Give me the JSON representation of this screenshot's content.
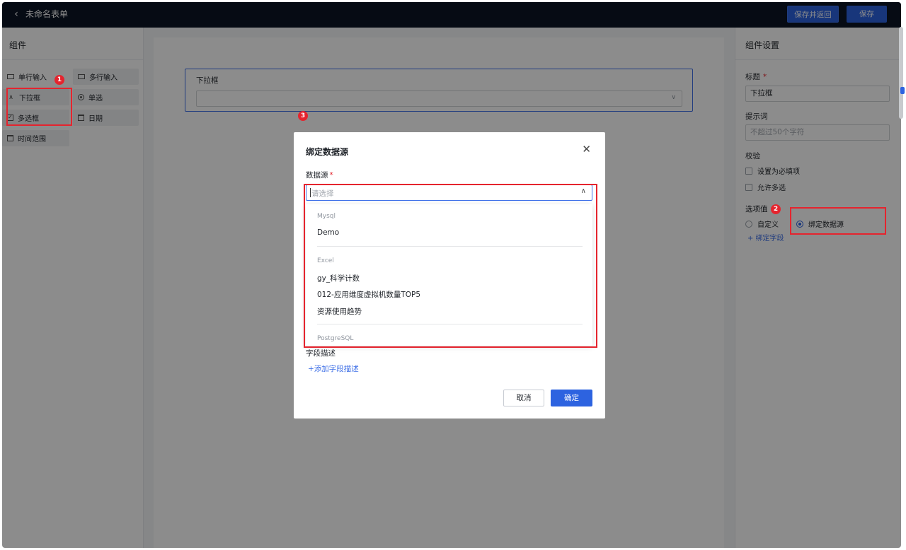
{
  "topbar": {
    "title": "未命名表单",
    "save_return_label": "保存并返回",
    "save_label": "保存"
  },
  "left_panel": {
    "title": "组件",
    "items": [
      {
        "label": "单行输入",
        "icon": "input-line-icon"
      },
      {
        "label": "多行输入",
        "icon": "textarea-icon"
      },
      {
        "label": "下拉框",
        "icon": "chevron-up-icon"
      },
      {
        "label": "单选",
        "icon": "radio-icon"
      },
      {
        "label": "多选框",
        "icon": "checkbox-icon"
      },
      {
        "label": "日期",
        "icon": "calendar-icon"
      },
      {
        "label": "时间范围",
        "icon": "calendar-icon"
      }
    ]
  },
  "canvas": {
    "field_label": "下拉框"
  },
  "right_panel": {
    "title": "组件设置",
    "title_label": "标题",
    "title_value": "下拉框",
    "hint_label": "提示词",
    "hint_placeholder": "不超过50个字符",
    "validate_label": "校验",
    "required_label": "设置为必填项",
    "multi_label": "允许多选",
    "options_label": "选项值",
    "custom_label": "自定义",
    "bind_source_label": "绑定数据源",
    "bind_field_link": "+ 绑定字段"
  },
  "modal": {
    "title": "绑定数据源",
    "datasource_label": "数据源",
    "select_placeholder": "请选择",
    "groups": [
      {
        "name": "Mysql",
        "items": [
          "Demo"
        ]
      },
      {
        "name": "Excel",
        "items": [
          "gy_科学计数",
          "012-应用维度虚拟机数量TOP5",
          "资源使用趋势"
        ]
      },
      {
        "name": "PostgreSQL",
        "items": []
      }
    ],
    "field_desc_label": "字段描述",
    "add_field_desc_link": "+添加字段描述",
    "cancel_label": "取消",
    "ok_label": "确定"
  },
  "annotations": [
    "1",
    "2",
    "3"
  ],
  "colors": {
    "topbar": "#0c1526",
    "primary": "#2d63e0",
    "highlight_red": "#e5242e",
    "link": "#3c6ee6"
  }
}
